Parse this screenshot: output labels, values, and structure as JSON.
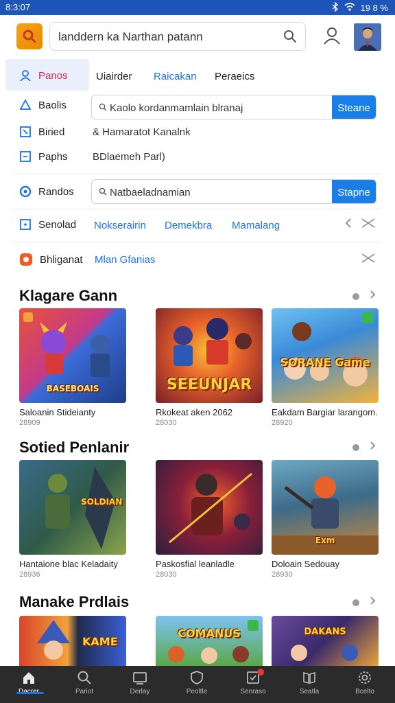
{
  "status": {
    "time": "8:3:07",
    "battery": "19 8 %"
  },
  "header": {
    "search_value": "landdern ka Narthan patann"
  },
  "nav": {
    "side_items": [
      {
        "label": "Panos",
        "icon": "person-icon"
      },
      {
        "label": "Baolis",
        "icon": "triangle-icon"
      },
      {
        "label": "Biried",
        "icon": "square-arrow-icon"
      },
      {
        "label": "Paphs",
        "icon": "minus-square-icon"
      },
      {
        "label": "Randos",
        "icon": "circle-icon"
      },
      {
        "label": "Senolad",
        "icon": "square-dot-icon"
      },
      {
        "label": "Bhliganat",
        "icon": "orange-badge-icon"
      }
    ],
    "top_tabs": [
      "Uiairder",
      "Raicakan",
      "Peraeics"
    ],
    "search1": {
      "value": "Kaolo kordanmamlain blranaj",
      "button": "Steane"
    },
    "text1": "& Hamaratot Kanalnk",
    "text2": "BDlaemeh Parl)",
    "search2": {
      "value": "Natbaeladnamian",
      "button": "Stapne"
    },
    "links_row1": [
      "Nokserairin",
      "Demekbra",
      "Mamalang"
    ],
    "links_row2": [
      "Mlan Gfanias"
    ]
  },
  "sections": [
    {
      "title": "Klagare Gann",
      "cards": [
        {
          "caption": "Saloanin Stideianty",
          "sub": "28909",
          "art": "BASEBOAIS",
          "colors": [
            "#e8523a",
            "#3b6bd8"
          ]
        },
        {
          "caption": "Rkokeat aken 2062",
          "sub": "28030",
          "art": "SEEUNJAR",
          "colors": [
            "#d9452b",
            "#f2a93b"
          ]
        },
        {
          "caption": "Eakdam Bargiar larangom.",
          "sub": "28920",
          "art": "SORANE Game",
          "colors": [
            "#3aa3e8",
            "#f2b33b"
          ]
        }
      ]
    },
    {
      "title": "Sotied Penlanir",
      "cards": [
        {
          "caption": "Hantaione blac Keladaity",
          "sub": "28936",
          "art": "SOLDIAN",
          "colors": [
            "#2f6b5a",
            "#8aa34a"
          ]
        },
        {
          "caption": "Paskosfial leanladle",
          "sub": "28030",
          "art": "",
          "colors": [
            "#2a1f3d",
            "#c2452a"
          ]
        },
        {
          "caption": "Doloain Sedouay",
          "sub": "28930",
          "art": "Exm",
          "colors": [
            "#3d6b8a",
            "#c98a3b"
          ]
        }
      ]
    },
    {
      "title": "Manake Prdlais",
      "cards": [
        {
          "caption": "",
          "sub": "",
          "art": "KAME",
          "colors": [
            "#d8452b",
            "#3b5fd8"
          ]
        },
        {
          "caption": "",
          "sub": "",
          "art": "COMANUS",
          "colors": [
            "#5ab0e8",
            "#e8c23b"
          ]
        },
        {
          "caption": "",
          "sub": "",
          "art": "DAKANS",
          "colors": [
            "#6b4a9e",
            "#e8a23b"
          ]
        }
      ]
    }
  ],
  "bottom_nav": [
    {
      "label": "Dacrer",
      "icon": "home-icon"
    },
    {
      "label": "Pariot",
      "icon": "search-icon"
    },
    {
      "label": "Derlay",
      "icon": "screen-icon"
    },
    {
      "label": "Peoltle",
      "icon": "shield-icon"
    },
    {
      "label": "Senraso",
      "icon": "checklist-icon"
    },
    {
      "label": "Seatla",
      "icon": "book-icon"
    },
    {
      "label": "Bcelto",
      "icon": "gear-icon"
    }
  ]
}
